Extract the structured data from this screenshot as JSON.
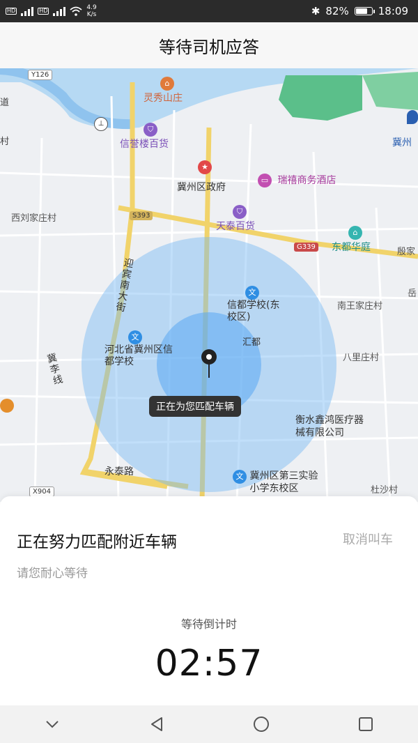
{
  "status_bar": {
    "network_speed": "4.9\nK/s",
    "battery": "82%",
    "battery_level": 0.82,
    "time": "18:09",
    "icons": [
      "hd-icon",
      "signal-icon",
      "wifi-icon",
      "bluetooth-icon",
      "battery-icon"
    ]
  },
  "header": {
    "title": "等待司机应答"
  },
  "map": {
    "callout": "正在为您匹配车辆",
    "roads": {
      "y126": "Y126",
      "s393": "S393",
      "g339": "G339",
      "x904": "X904"
    },
    "labels": {
      "lingxiu": "灵秀山庄",
      "xinyu": "信誉楼百货",
      "jizhou_gov": "冀州区政府",
      "ruixiang": "瑞禧商务酒店",
      "xiliu": "西刘家庄村",
      "tiantai": "天泰百货",
      "dongdu": "东都华庭",
      "yingbin": "迎宾南大街",
      "xindu_school": "信都学校(东校区)",
      "nanwang": "南王家庄村",
      "hebei_school": "河北省冀州区信都学校",
      "jili": "冀李线",
      "bali": "八里庄村",
      "hengshui": "衡水鑫鸿医疗器械有限公司",
      "yongtai": "永泰路",
      "jizhou_third": "冀州区第三实验小学东校区",
      "dusha": "杜沙村",
      "edge_dao": "道",
      "edge_cun": "村",
      "edge_yin": "殷家",
      "edge_yue": "岳",
      "edge_jizhou": "冀州",
      "edge_hui": "汇都"
    }
  },
  "panel": {
    "headline": "正在努力匹配附近车辆",
    "cancel": "取消叫车",
    "subtitle": "请您耐心等待",
    "countdown_label": "等待倒计时",
    "countdown": "02:57"
  },
  "nav": [
    "chevron-down-icon",
    "back-triangle-icon",
    "home-circle-icon",
    "recents-square-icon"
  ]
}
